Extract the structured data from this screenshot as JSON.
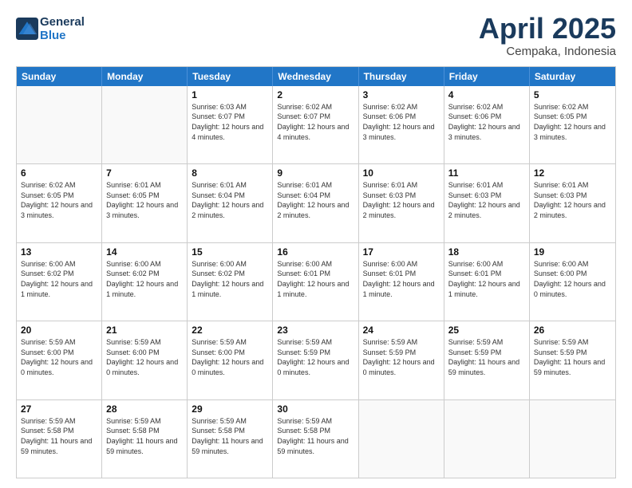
{
  "header": {
    "logo_line1": "General",
    "logo_line2": "Blue",
    "month_title": "April 2025",
    "location": "Cempaka, Indonesia"
  },
  "weekdays": [
    "Sunday",
    "Monday",
    "Tuesday",
    "Wednesday",
    "Thursday",
    "Friday",
    "Saturday"
  ],
  "rows": [
    [
      {
        "day": "",
        "info": ""
      },
      {
        "day": "",
        "info": ""
      },
      {
        "day": "1",
        "info": "Sunrise: 6:03 AM\nSunset: 6:07 PM\nDaylight: 12 hours\nand 4 minutes."
      },
      {
        "day": "2",
        "info": "Sunrise: 6:02 AM\nSunset: 6:07 PM\nDaylight: 12 hours\nand 4 minutes."
      },
      {
        "day": "3",
        "info": "Sunrise: 6:02 AM\nSunset: 6:06 PM\nDaylight: 12 hours\nand 3 minutes."
      },
      {
        "day": "4",
        "info": "Sunrise: 6:02 AM\nSunset: 6:06 PM\nDaylight: 12 hours\nand 3 minutes."
      },
      {
        "day": "5",
        "info": "Sunrise: 6:02 AM\nSunset: 6:05 PM\nDaylight: 12 hours\nand 3 minutes."
      }
    ],
    [
      {
        "day": "6",
        "info": "Sunrise: 6:02 AM\nSunset: 6:05 PM\nDaylight: 12 hours\nand 3 minutes."
      },
      {
        "day": "7",
        "info": "Sunrise: 6:01 AM\nSunset: 6:05 PM\nDaylight: 12 hours\nand 3 minutes."
      },
      {
        "day": "8",
        "info": "Sunrise: 6:01 AM\nSunset: 6:04 PM\nDaylight: 12 hours\nand 2 minutes."
      },
      {
        "day": "9",
        "info": "Sunrise: 6:01 AM\nSunset: 6:04 PM\nDaylight: 12 hours\nand 2 minutes."
      },
      {
        "day": "10",
        "info": "Sunrise: 6:01 AM\nSunset: 6:03 PM\nDaylight: 12 hours\nand 2 minutes."
      },
      {
        "day": "11",
        "info": "Sunrise: 6:01 AM\nSunset: 6:03 PM\nDaylight: 12 hours\nand 2 minutes."
      },
      {
        "day": "12",
        "info": "Sunrise: 6:01 AM\nSunset: 6:03 PM\nDaylight: 12 hours\nand 2 minutes."
      }
    ],
    [
      {
        "day": "13",
        "info": "Sunrise: 6:00 AM\nSunset: 6:02 PM\nDaylight: 12 hours\nand 1 minute."
      },
      {
        "day": "14",
        "info": "Sunrise: 6:00 AM\nSunset: 6:02 PM\nDaylight: 12 hours\nand 1 minute."
      },
      {
        "day": "15",
        "info": "Sunrise: 6:00 AM\nSunset: 6:02 PM\nDaylight: 12 hours\nand 1 minute."
      },
      {
        "day": "16",
        "info": "Sunrise: 6:00 AM\nSunset: 6:01 PM\nDaylight: 12 hours\nand 1 minute."
      },
      {
        "day": "17",
        "info": "Sunrise: 6:00 AM\nSunset: 6:01 PM\nDaylight: 12 hours\nand 1 minute."
      },
      {
        "day": "18",
        "info": "Sunrise: 6:00 AM\nSunset: 6:01 PM\nDaylight: 12 hours\nand 1 minute."
      },
      {
        "day": "19",
        "info": "Sunrise: 6:00 AM\nSunset: 6:00 PM\nDaylight: 12 hours\nand 0 minutes."
      }
    ],
    [
      {
        "day": "20",
        "info": "Sunrise: 5:59 AM\nSunset: 6:00 PM\nDaylight: 12 hours\nand 0 minutes."
      },
      {
        "day": "21",
        "info": "Sunrise: 5:59 AM\nSunset: 6:00 PM\nDaylight: 12 hours\nand 0 minutes."
      },
      {
        "day": "22",
        "info": "Sunrise: 5:59 AM\nSunset: 6:00 PM\nDaylight: 12 hours\nand 0 minutes."
      },
      {
        "day": "23",
        "info": "Sunrise: 5:59 AM\nSunset: 5:59 PM\nDaylight: 12 hours\nand 0 minutes."
      },
      {
        "day": "24",
        "info": "Sunrise: 5:59 AM\nSunset: 5:59 PM\nDaylight: 12 hours\nand 0 minutes."
      },
      {
        "day": "25",
        "info": "Sunrise: 5:59 AM\nSunset: 5:59 PM\nDaylight: 11 hours\nand 59 minutes."
      },
      {
        "day": "26",
        "info": "Sunrise: 5:59 AM\nSunset: 5:59 PM\nDaylight: 11 hours\nand 59 minutes."
      }
    ],
    [
      {
        "day": "27",
        "info": "Sunrise: 5:59 AM\nSunset: 5:58 PM\nDaylight: 11 hours\nand 59 minutes."
      },
      {
        "day": "28",
        "info": "Sunrise: 5:59 AM\nSunset: 5:58 PM\nDaylight: 11 hours\nand 59 minutes."
      },
      {
        "day": "29",
        "info": "Sunrise: 5:59 AM\nSunset: 5:58 PM\nDaylight: 11 hours\nand 59 minutes."
      },
      {
        "day": "30",
        "info": "Sunrise: 5:59 AM\nSunset: 5:58 PM\nDaylight: 11 hours\nand 59 minutes."
      },
      {
        "day": "",
        "info": ""
      },
      {
        "day": "",
        "info": ""
      },
      {
        "day": "",
        "info": ""
      }
    ]
  ]
}
